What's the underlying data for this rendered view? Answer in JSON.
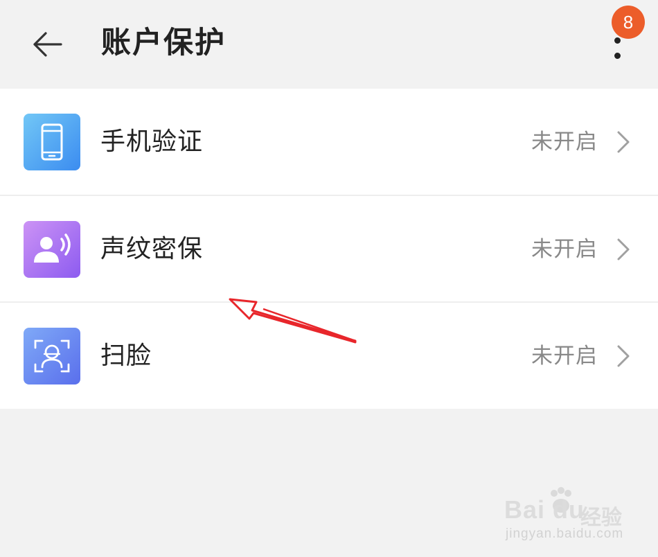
{
  "header": {
    "title": "账户保护",
    "badge_count": "8",
    "back_icon": "arrow-left-icon",
    "more_icon": "more-vertical-icon"
  },
  "items": [
    {
      "label": "手机验证",
      "status": "未开启",
      "icon": "phone-icon",
      "color_from": "#6cc1f5",
      "color_to": "#3a8ff0"
    },
    {
      "label": "声纹密保",
      "status": "未开启",
      "icon": "voiceprint-icon",
      "color_from": "#c48af4",
      "color_to": "#8f5cf0"
    },
    {
      "label": "扫脸",
      "status": "未开启",
      "icon": "face-scan-icon",
      "color_from": "#7aa4f6",
      "color_to": "#5d73ec"
    }
  ],
  "watermark": {
    "brand": "Bai du",
    "brand_cn": "经验",
    "url": "jingyan.baidu.com"
  },
  "colors": {
    "badge": "#ec5d2a",
    "annotation_arrow": "#e8262b",
    "background": "#f2f2f2"
  }
}
